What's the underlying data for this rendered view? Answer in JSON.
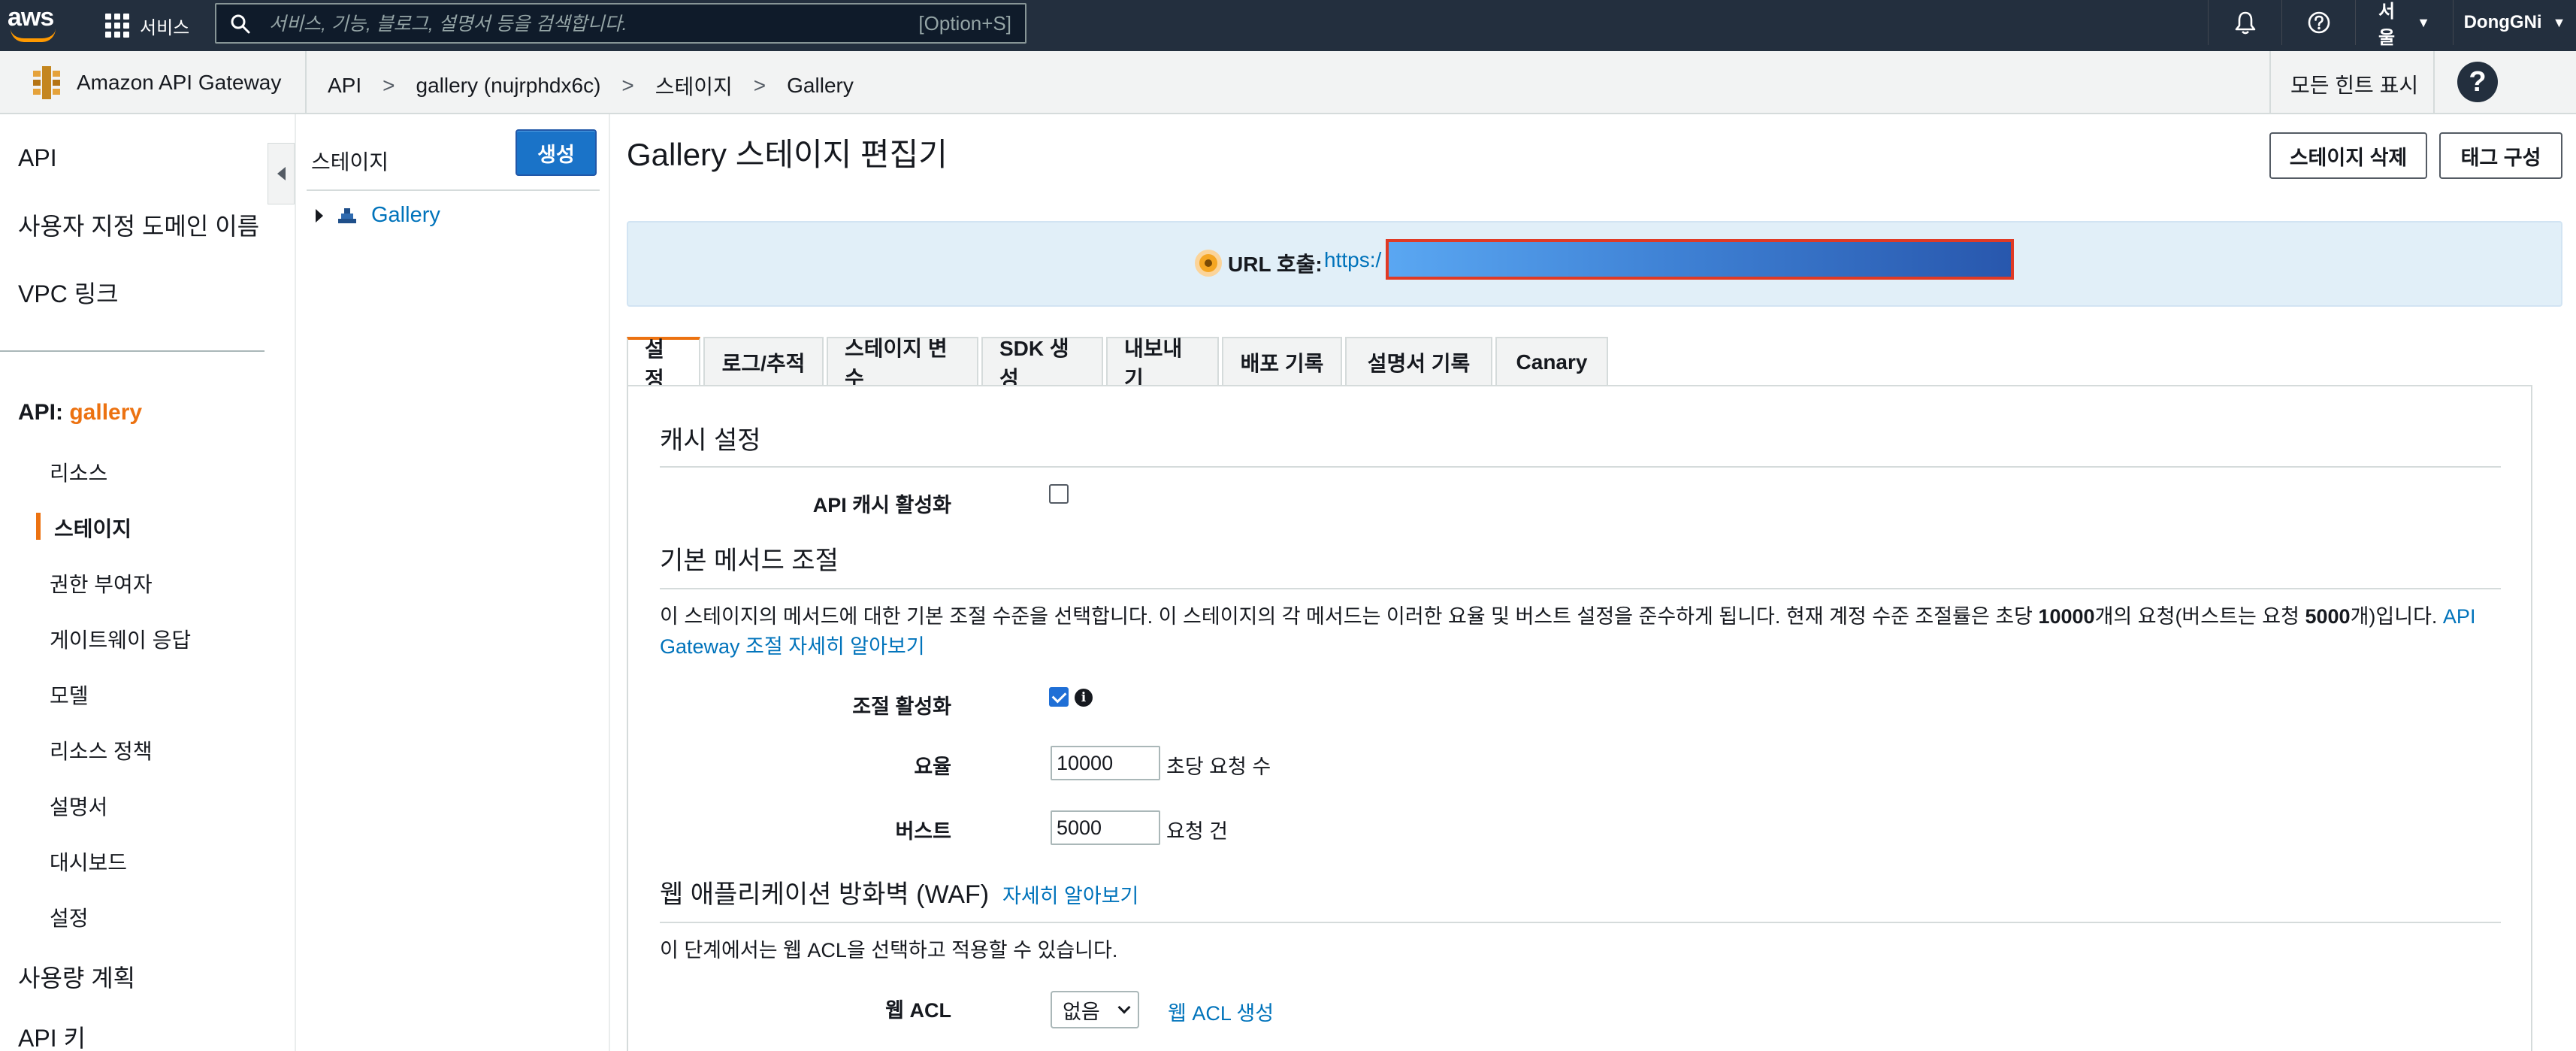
{
  "topnav": {
    "services_label": "서비스",
    "search_placeholder": "서비스, 기능, 블로그, 설명서 등을 검색합니다.",
    "search_shortcut": "[Option+S]",
    "region": "서울",
    "user": "DongGNi"
  },
  "servicebar": {
    "service_name": "Amazon API Gateway",
    "breadcrumb": [
      "API",
      "gallery (nujrphdx6c)",
      "스테이지",
      "Gallery"
    ],
    "breadcrumb_sep": ">",
    "hints": "모든 힌트 표시",
    "help_glyph": "?"
  },
  "leftnav": {
    "top_items": [
      "API",
      "사용자 지정 도메인 이름",
      "VPC 링크"
    ],
    "api_prefix": "API:",
    "api_name": "gallery",
    "sub_items": [
      "리소스",
      "스테이지",
      "권한 부여자",
      "게이트웨이 응답",
      "모델",
      "리소스 정책",
      "설명서",
      "대시보드",
      "설정"
    ],
    "active_item": "스테이지",
    "bottom_items": [
      "사용량 계획",
      "API 키"
    ]
  },
  "stagepanel": {
    "title": "스테이지",
    "create_label": "생성",
    "tree": [
      "Gallery"
    ]
  },
  "main": {
    "title": "Gallery 스테이지 편집기",
    "delete_label": "스테이지 삭제",
    "tags_label": "태그 구성",
    "url_label": "URL 호출:",
    "url_value": "https:/",
    "tabs": [
      "설정",
      "로그/추적",
      "스테이지 변수",
      "SDK 생성",
      "내보내기",
      "배포 기록",
      "설명서 기록",
      "Canary"
    ],
    "active_tab": "설정"
  },
  "settings": {
    "cache_title": "캐시 설정",
    "cache_label": "API 캐시 활성화",
    "cache_enabled": false,
    "throttle_title": "기본 메서드 조절",
    "throttle_desc_1": "이 스테이지의 메서드에 대한 기본 조절 수준을 선택합니다. 이 스테이지의 각 메서드는 이러한 요율 및 버스트 설정을 준수하게 됩니다. 현재 계정 수준 조절률은 초당 ",
    "throttle_desc_rate": "10000",
    "throttle_desc_2": "개의 요청(버스트는 요청 ",
    "throttle_desc_burst": "5000",
    "throttle_desc_3": "개)입니다. ",
    "throttle_desc_link_1": "API",
    "throttle_desc_link_2": "Gateway 조절 자세히 알아보기",
    "throttle_enabled_label": "조절 활성화",
    "throttle_enabled": true,
    "rate_label": "요율",
    "rate_value": "10000",
    "rate_unit": "초당 요청 수",
    "burst_label": "버스트",
    "burst_value": "5000",
    "burst_unit": "요청 건",
    "waf_title": "웹 애플리케이션 방화벽 (WAF)",
    "waf_learn_more": "자세히 알아보기",
    "waf_desc": "이 단계에서는 웹 ACL을 선택하고 적용할 수 있습니다.",
    "web_acl_label": "웹 ACL",
    "web_acl_value": "없음",
    "web_acl_create": "웹 ACL 생성"
  },
  "colors": {
    "nav_bg": "#232f3e",
    "accent_orange": "#ec7211",
    "link_blue": "#0073bb",
    "primary_button": "#1a73c8",
    "url_banner_bg": "#e1eff8"
  }
}
